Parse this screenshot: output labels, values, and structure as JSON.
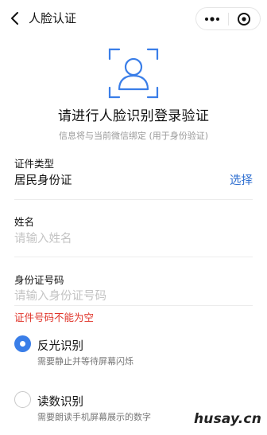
{
  "header": {
    "title": "人脸认证",
    "back_icon": "chevron-left-icon",
    "more_icon": "more-dots-icon",
    "close_icon": "target-circle-icon"
  },
  "hero": {
    "icon": "face-scan-icon",
    "title": "请进行人脸识别登录验证",
    "subtitle": "信息将与当前微信绑定 (用于身份验证)"
  },
  "form": {
    "id_type": {
      "label": "证件类型",
      "value": "居民身份证",
      "action": "选择"
    },
    "name": {
      "label": "姓名",
      "placeholder": "请输入姓名",
      "value": ""
    },
    "id_number": {
      "label": "身份证号码",
      "placeholder": "请输入身份证号码",
      "value": "",
      "error": "证件号码不能为空"
    }
  },
  "options": [
    {
      "title": "反光识别",
      "desc": "需要静止并等待屏幕闪烁",
      "selected": true
    },
    {
      "title": "读数识别",
      "desc": "需要朗读手机屏幕展示的数字",
      "selected": false
    }
  ],
  "watermark": "husay.cn",
  "colors": {
    "accent": "#3a7ee8",
    "link": "#2f6fd0",
    "error": "#e0352b",
    "placeholder": "#c4c4c4"
  }
}
